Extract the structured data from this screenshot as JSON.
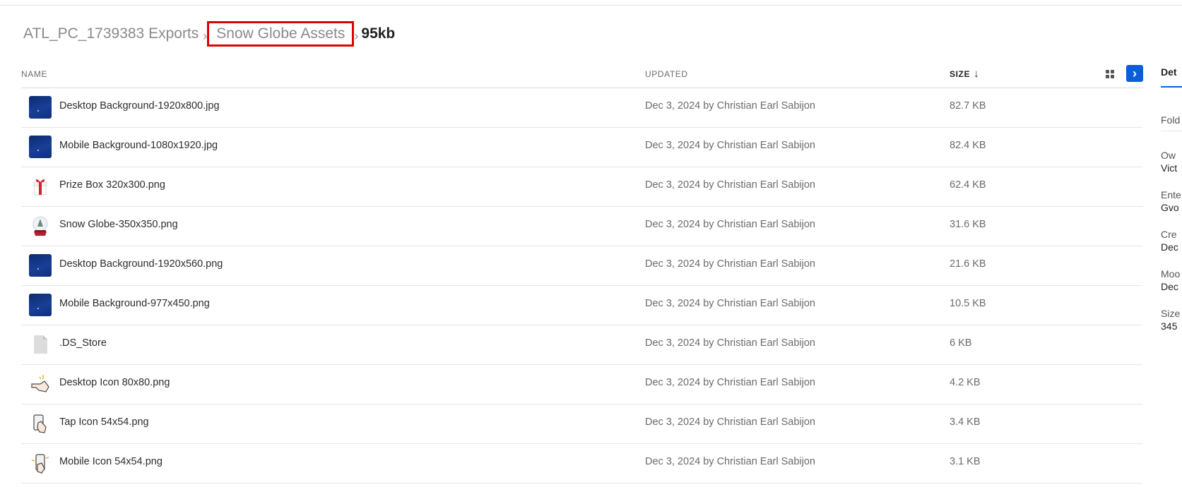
{
  "breadcrumb": {
    "items": [
      "ATL_PC_1739383 Exports",
      "Snow Globe Assets",
      "95kb"
    ],
    "separator": "›"
  },
  "table": {
    "headers": {
      "name": "NAME",
      "updated": "UPDATED",
      "size": "SIZE"
    },
    "sort_icon": "arrow-down-icon",
    "rows": [
      {
        "name": "Desktop Background-1920x800.jpg",
        "updated": "Dec 3, 2024 by Christian Earl Sabijon",
        "size": "82.7 KB",
        "thumb": "image-thumbnail"
      },
      {
        "name": "Mobile Background-1080x1920.jpg",
        "updated": "Dec 3, 2024 by Christian Earl Sabijon",
        "size": "82.4 KB",
        "thumb": "image-thumbnail"
      },
      {
        "name": "Prize Box 320x300.png",
        "updated": "Dec 3, 2024 by Christian Earl Sabijon",
        "size": "62.4 KB",
        "thumb": "gift-box-thumbnail"
      },
      {
        "name": "Snow Globe-350x350.png",
        "updated": "Dec 3, 2024 by Christian Earl Sabijon",
        "size": "31.6 KB",
        "thumb": "snow-globe-thumbnail"
      },
      {
        "name": "Desktop Background-1920x560.png",
        "updated": "Dec 3, 2024 by Christian Earl Sabijon",
        "size": "21.6 KB",
        "thumb": "image-thumbnail"
      },
      {
        "name": "Mobile Background-977x450.png",
        "updated": "Dec 3, 2024 by Christian Earl Sabijon",
        "size": "10.5 KB",
        "thumb": "image-thumbnail"
      },
      {
        "name": ".DS_Store",
        "updated": "Dec 3, 2024 by Christian Earl Sabijon",
        "size": "6 KB",
        "thumb": "file-icon"
      },
      {
        "name": "Desktop Icon 80x80.png",
        "updated": "Dec 3, 2024 by Christian Earl Sabijon",
        "size": "4.2 KB",
        "thumb": "hand-pointer-thumbnail"
      },
      {
        "name": "Tap Icon 54x54.png",
        "updated": "Dec 3, 2024 by Christian Earl Sabijon",
        "size": "3.4 KB",
        "thumb": "tap-phone-thumbnail"
      },
      {
        "name": "Mobile Icon 54x54.png",
        "updated": "Dec 3, 2024 by Christian Earl Sabijon",
        "size": "3.1 KB",
        "thumb": "mobile-shake-thumbnail"
      }
    ]
  },
  "toolbar": {
    "grid_view_icon": "grid-view-icon",
    "expand_icon": "chevron-right-icon"
  },
  "details_panel": {
    "tab_label": "Det",
    "labels": [
      "Fold",
      "Ow",
      "Ente",
      "Cre",
      "Moo",
      "Size"
    ],
    "values": [
      "Vict",
      "Gvo",
      "Dec",
      "Dec",
      "345"
    ]
  },
  "colors": {
    "accent": "#0b5ed7",
    "highlight": "#e00000",
    "thumb_bg": "#12348a"
  }
}
